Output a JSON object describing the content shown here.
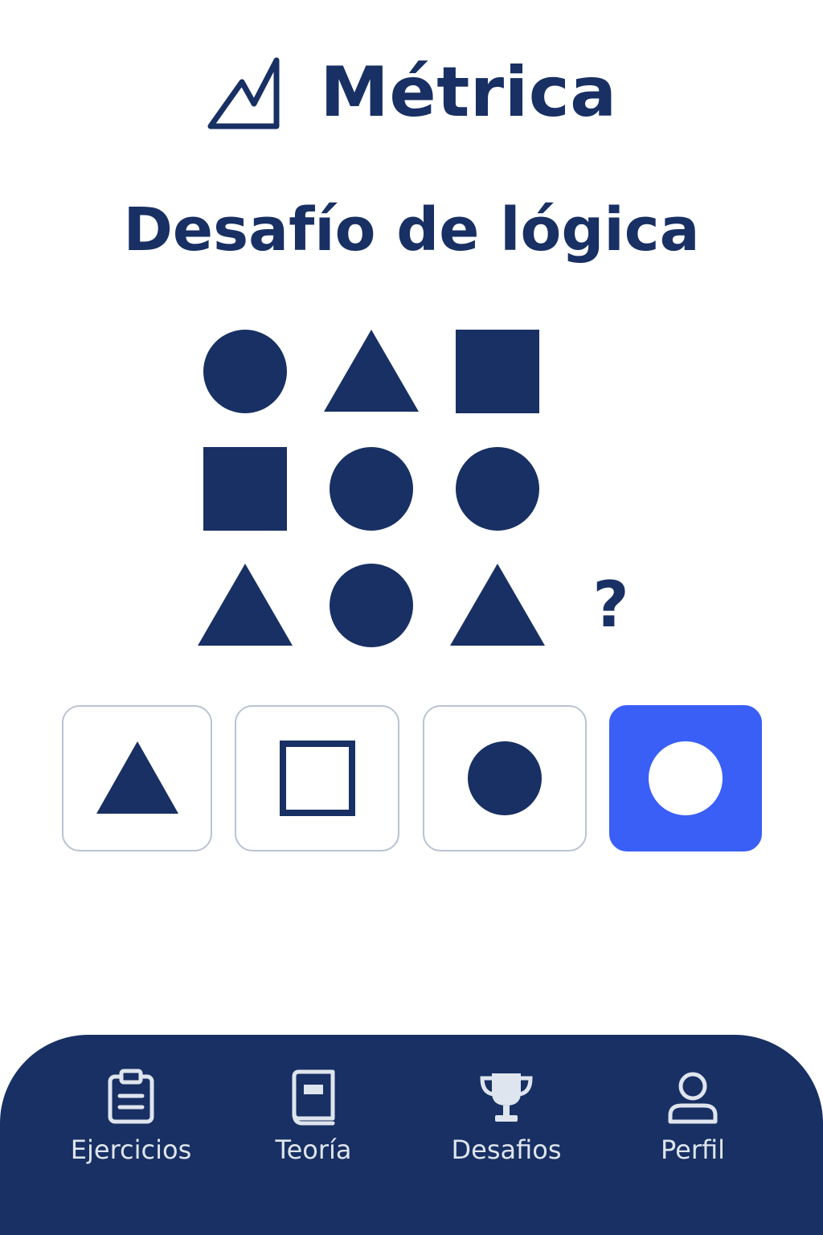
{
  "app": {
    "name": "Métrica",
    "logo_icon": "chart-line-icon"
  },
  "challenge": {
    "title": "Desafío de lógica",
    "unknown_marker": "?",
    "grid": [
      [
        "circle",
        "triangle",
        "square"
      ],
      [
        "square",
        "circle",
        "circle"
      ],
      [
        "triangle",
        "circle",
        "triangle"
      ]
    ]
  },
  "options": [
    {
      "shape": "filled-triangle",
      "selected": false
    },
    {
      "shape": "outline-square",
      "selected": false
    },
    {
      "shape": "filled-circle",
      "selected": false
    },
    {
      "shape": "ring",
      "selected": true
    }
  ],
  "bottom_nav": {
    "items": [
      {
        "label": "Ejercicios",
        "icon": "clipboard-icon"
      },
      {
        "label": "Teoría",
        "icon": "book-icon"
      },
      {
        "label": "Desafios",
        "icon": "trophy-icon"
      },
      {
        "label": "Perfil",
        "icon": "user-icon"
      }
    ]
  },
  "colors": {
    "primary": "#183063",
    "accent": "#3a5ff7",
    "option_border": "#b9c3d3",
    "nav_text": "#dfe5ee",
    "background": "#ffffff"
  }
}
